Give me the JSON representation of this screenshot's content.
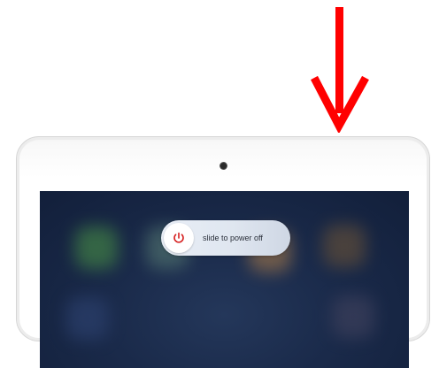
{
  "annotation": {
    "arrow_icon": "red-down-arrow-icon",
    "arrow_color": "#ff0000"
  },
  "device": {
    "type": "ipad",
    "camera_icon": "front-camera-dot"
  },
  "power_slider": {
    "label": "slide to power off",
    "knob_icon": "power-icon",
    "icon_color": "#d62020"
  }
}
